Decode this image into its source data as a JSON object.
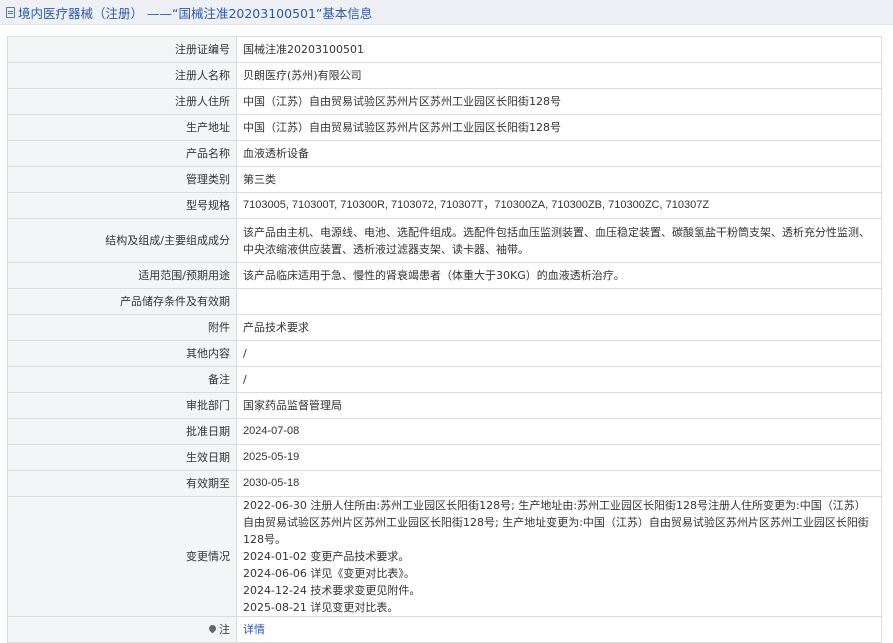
{
  "header": {
    "title": "境内医疗器械（注册） ——“国械注准20203100501”基本信息"
  },
  "rows": [
    {
      "label": "注册证编号",
      "value": "国械注准20203100501"
    },
    {
      "label": "注册人名称",
      "value": "贝朗医疗(苏州)有限公司"
    },
    {
      "label": "注册人住所",
      "value": "中国（江苏）自由贸易试验区苏州片区苏州工业园区长阳街128号"
    },
    {
      "label": "生产地址",
      "value": "中国（江苏）自由贸易试验区苏州片区苏州工业园区长阳街128号"
    },
    {
      "label": "产品名称",
      "value": "血液透析设备"
    },
    {
      "label": "管理类别",
      "value": "第三类"
    },
    {
      "label": "型号规格",
      "value": "7103005, 710300T, 710300R, 7103072, 710307T，710300ZA, 710300ZB, 710300ZC, 710307Z"
    },
    {
      "label": "结构及组成/主要组成成分",
      "value": "该产品由主机、电源线、电池、选配件组成。选配件包括血压监测装置、血压稳定装置、碳酸氢盐干粉筒支架、透析充分性监测、中央浓缩液供应装置、透析液过滤器支架、读卡器、袖带。"
    },
    {
      "label": "适用范围/预期用途",
      "value": "该产品临床适用于急、慢性的肾衰竭患者（体重大于30KG）的血液透析治疗。"
    },
    {
      "label": "产品储存条件及有效期",
      "value": ""
    },
    {
      "label": "附件",
      "value": "产品技术要求"
    },
    {
      "label": "其他内容",
      "value": "/"
    },
    {
      "label": "备注",
      "value": "/"
    },
    {
      "label": "审批部门",
      "value": "国家药品监督管理局"
    },
    {
      "label": "批准日期",
      "value": "2024-07-08"
    },
    {
      "label": "生效日期",
      "value": "2025-05-19"
    },
    {
      "label": "有效期至",
      "value": "2030-05-18"
    }
  ],
  "changes": {
    "label": "变更情况",
    "entries": [
      "2022-06-30 注册人住所由:苏州工业园区长阳街128号; 生产地址由:苏州工业园区长阳街128号注册人住所变更为:中国（江苏）自由贸易试验区苏州片区苏州工业园区长阳街128号; 生产地址变更为:中国（江苏）自由贸易试验区苏州片区苏州工业园区长阳街128号。",
      "2024-01-02 变更产品技术要求。",
      "2024-06-06 详见《变更对比表》。",
      "2024-12-24 技术要求变更见附件。",
      "2025-08-21 详见变更对比表。"
    ]
  },
  "note": {
    "label": "注",
    "icon": "pin-icon",
    "link_text": "详情"
  }
}
